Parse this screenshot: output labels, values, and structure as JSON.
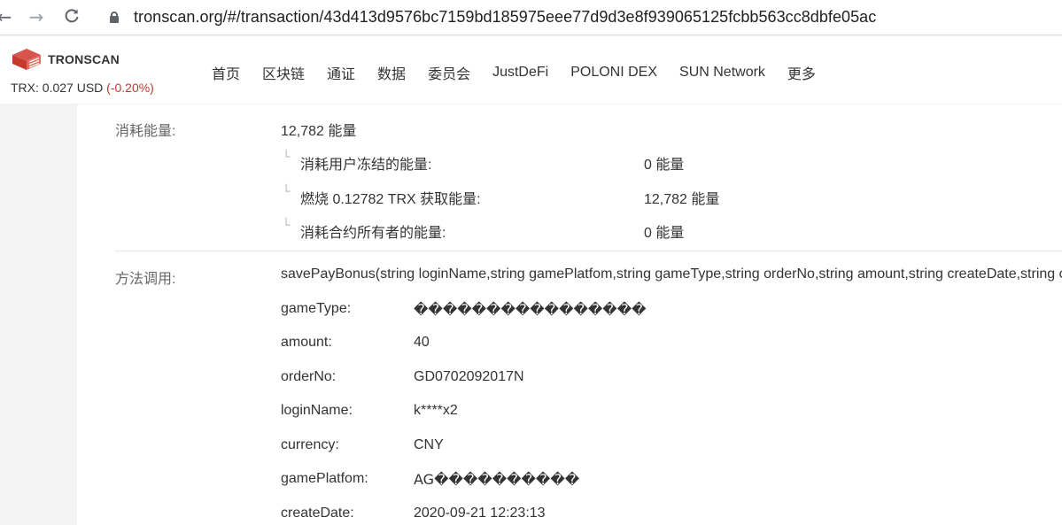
{
  "browser": {
    "url": "tronscan.org/#/transaction/43d413d9576bc7159bd185975eee77d9d3e8f939065125fcbb563cc8dbfe05ac",
    "back_icon": "arrow-left",
    "forward_icon": "arrow-right",
    "reload_icon": "reload"
  },
  "header": {
    "logo_text": "TRONSCAN",
    "price_label": "TRX: 0.027 USD",
    "price_change": "(-0.20%)",
    "menu": [
      "首页",
      "区块链",
      "通证",
      "数据",
      "委员会",
      "JustDeFi",
      "POLONI DEX",
      "SUN Network",
      "更多"
    ]
  },
  "energy": {
    "label": "消耗能量:",
    "total": "12,782 能量",
    "breakdown": [
      {
        "label": "消耗用户冻结的能量:",
        "value": "0 能量"
      },
      {
        "label": "燃烧 0.12782 TRX 获取能量:",
        "value": "12,782 能量"
      },
      {
        "label": "消耗合约所有者的能量:",
        "value": "0 能量"
      }
    ]
  },
  "method": {
    "label": "方法调用:",
    "signature": "savePayBonus(string loginName,string gamePlatfom,string gameType,string orderNo,string amount,string createDate,string currency)",
    "params": [
      {
        "name": "gameType:",
        "value": "����������������"
      },
      {
        "name": "amount:",
        "value": "40"
      },
      {
        "name": "orderNo:",
        "value": "GD0702092017N"
      },
      {
        "name": "loginName:",
        "value": "k****x2"
      },
      {
        "name": "currency:",
        "value": "CNY"
      },
      {
        "name": "gamePlatfom:",
        "value": "AG����������"
      },
      {
        "name": "createDate:",
        "value": "2020-09-21 12:23:13"
      }
    ]
  },
  "colors": {
    "negative": "#c23631",
    "logo_red": "#c53a2c"
  }
}
